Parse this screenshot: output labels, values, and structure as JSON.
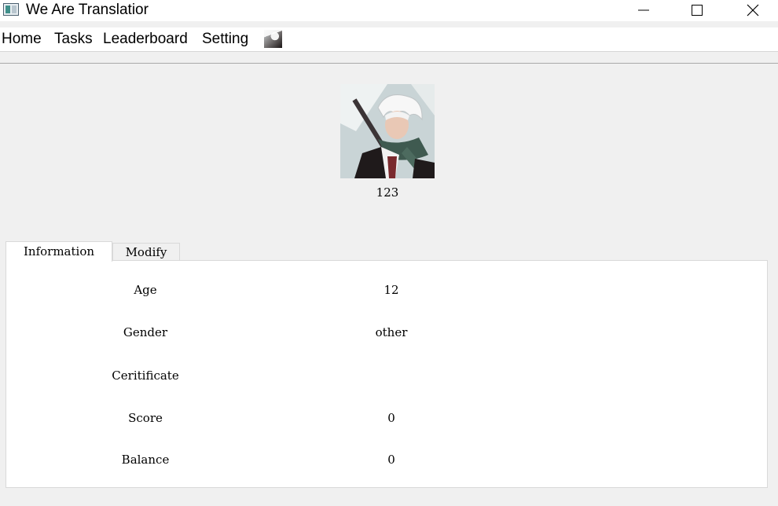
{
  "window": {
    "title": "We Are Translatior",
    "minimize_icon": "minimize-icon",
    "maximize_icon": "maximize-icon",
    "close_icon": "close-icon"
  },
  "menu": {
    "items": [
      {
        "label": "Home"
      },
      {
        "label": "Tasks"
      },
      {
        "label": "Leaderboard"
      },
      {
        "label": "Setting"
      }
    ],
    "avatar_icon": "user-avatar-thumbnail"
  },
  "profile": {
    "username": "123"
  },
  "tabs": [
    {
      "label": "Information",
      "active": true
    },
    {
      "label": "Modify",
      "active": false
    }
  ],
  "information": {
    "rows": [
      {
        "label": "Age",
        "value": "12"
      },
      {
        "label": "Gender",
        "value": "other"
      },
      {
        "label": "Ceritificate",
        "value": ""
      },
      {
        "label": "Score",
        "value": "0"
      },
      {
        "label": "Balance",
        "value": "0"
      }
    ]
  }
}
